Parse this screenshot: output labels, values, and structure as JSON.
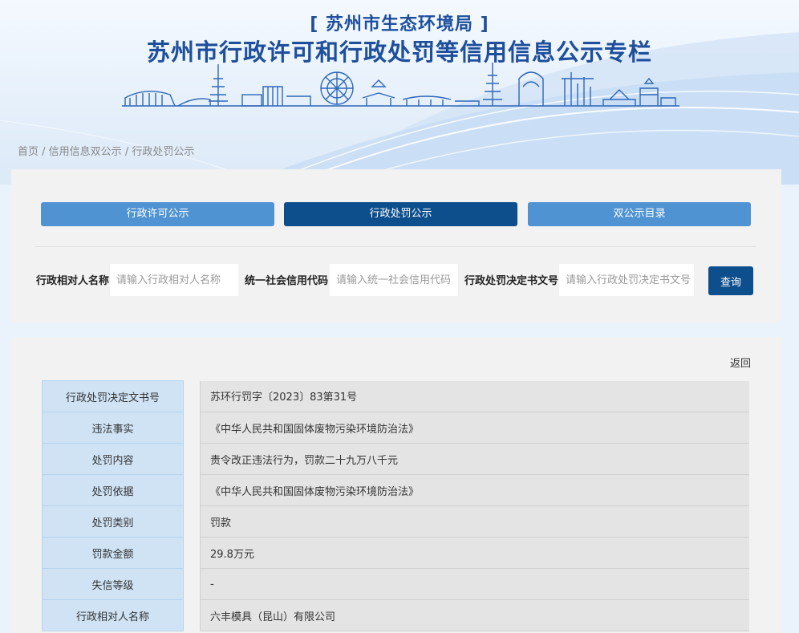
{
  "header": {
    "agency": "[ 苏州市生态环境局 ]",
    "title": "苏州市行政许可和行政处罚等信用信息公示专栏"
  },
  "breadcrumb": {
    "home": "首页",
    "sep1": " / ",
    "level2": "信用信息双公示",
    "sep2": " / ",
    "current": "行政处罚公示"
  },
  "tabs": [
    {
      "label": "行政许可公示",
      "active": false
    },
    {
      "label": "行政处罚公示",
      "active": true
    },
    {
      "label": "双公示目录",
      "active": false
    }
  ],
  "search": {
    "name_label": "行政相对人名称",
    "name_placeholder": "请输入行政相对人名称",
    "code_label": "统一社会信用代码",
    "code_placeholder": "请输入统一社会信用代码",
    "doc_label": "行政处罚决定书文号",
    "doc_placeholder": "请输入行政处罚决定书文号",
    "query_label": "查询"
  },
  "result": {
    "back_label": "返回",
    "rows": [
      {
        "key": "行政处罚决定文书号",
        "value": "苏环行罚字〔2023〕83第31号"
      },
      {
        "key": "违法事实",
        "value": "《中华人民共和国固体废物污染环境防治法》"
      },
      {
        "key": "处罚内容",
        "value": "责令改正违法行为，罚款二十九万八千元"
      },
      {
        "key": "处罚依据",
        "value": "《中华人民共和国固体废物污染环境防治法》"
      },
      {
        "key": "处罚类别",
        "value": "罚款"
      },
      {
        "key": "罚款金额",
        "value": "29.8万元"
      },
      {
        "key": "失信等级",
        "value": "-"
      },
      {
        "key": "行政相对人名称",
        "value": "六丰模具（昆山）有限公司"
      }
    ]
  },
  "colors": {
    "brand_blue": "#1e4f9c",
    "tab_active": "#0d4e8d",
    "tab_inactive": "#4f93d3",
    "key_cell": "#cfe3f5",
    "value_cell": "#e4e4e4"
  }
}
